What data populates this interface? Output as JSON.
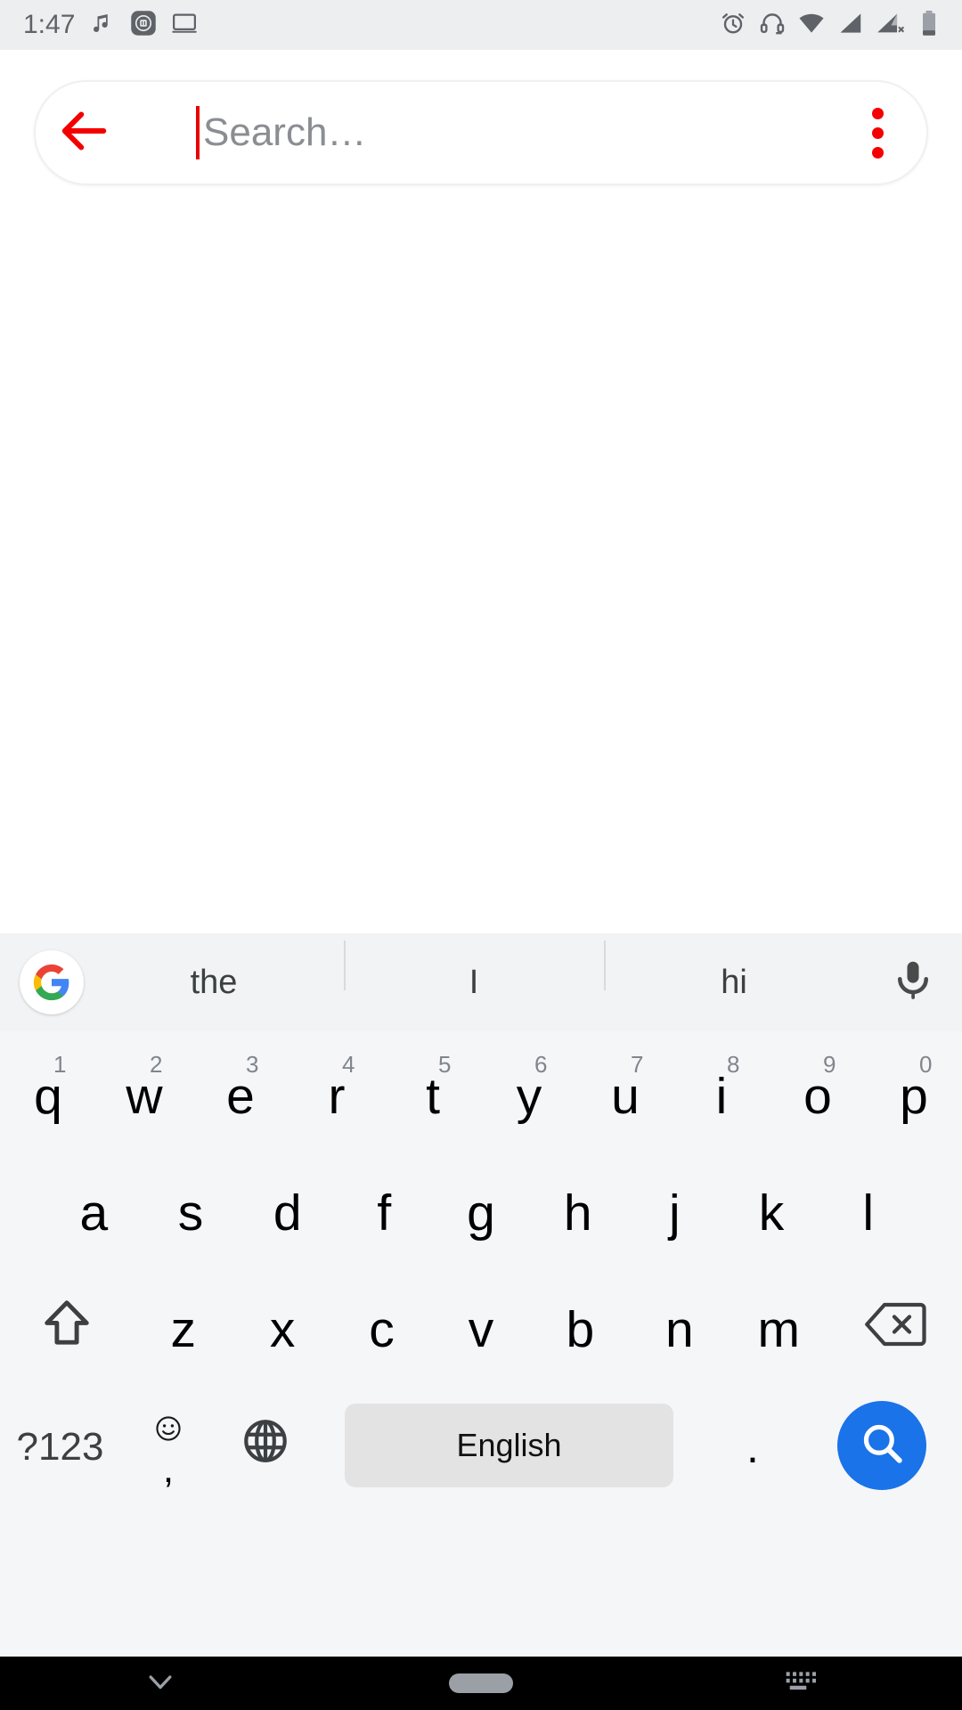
{
  "status_bar": {
    "time": "1:47",
    "left_icons": [
      {
        "name": "music-note-icon",
        "label": "Music playing"
      },
      {
        "name": "mi-app-icon",
        "label": "Mi"
      },
      {
        "name": "cast-screen-icon",
        "label": "Screen cast"
      }
    ],
    "right_icons": [
      {
        "name": "alarm-clock-icon",
        "label": "Alarm set"
      },
      {
        "name": "headset-icon",
        "label": "Headset connected"
      },
      {
        "name": "wifi-icon",
        "label": "Wi-Fi"
      },
      {
        "name": "signal-bars-icon",
        "label": "Signal SIM1"
      },
      {
        "name": "signal-bars-no-service-icon",
        "label": "No service SIM2"
      },
      {
        "name": "battery-icon",
        "label": "Battery"
      }
    ],
    "background": "#eceef0",
    "foreground": "#5f6368"
  },
  "search": {
    "placeholder": "Search…",
    "value": "",
    "back_icon": "arrow-left-icon",
    "overflow_icon": "more-vertical-icon",
    "accent": "#ea0000",
    "caret_color": "#ea0000"
  },
  "keyboard": {
    "logo": "google-g-logo",
    "suggestions": [
      "the",
      "I",
      "hi"
    ],
    "mic_icon": "microphone-icon",
    "rows": {
      "row1": [
        {
          "key": "q",
          "hint": "1"
        },
        {
          "key": "w",
          "hint": "2"
        },
        {
          "key": "e",
          "hint": "3"
        },
        {
          "key": "r",
          "hint": "4"
        },
        {
          "key": "t",
          "hint": "5"
        },
        {
          "key": "y",
          "hint": "6"
        },
        {
          "key": "u",
          "hint": "7"
        },
        {
          "key": "i",
          "hint": "8"
        },
        {
          "key": "o",
          "hint": "9"
        },
        {
          "key": "p",
          "hint": "0"
        }
      ],
      "row2": [
        {
          "key": "a"
        },
        {
          "key": "s"
        },
        {
          "key": "d"
        },
        {
          "key": "f"
        },
        {
          "key": "g"
        },
        {
          "key": "h"
        },
        {
          "key": "j"
        },
        {
          "key": "k"
        },
        {
          "key": "l"
        }
      ],
      "row3": [
        {
          "key": "z"
        },
        {
          "key": "x"
        },
        {
          "key": "c"
        },
        {
          "key": "v"
        },
        {
          "key": "b"
        },
        {
          "key": "n"
        },
        {
          "key": "m"
        }
      ]
    },
    "shift_icon": "shift-arrow-icon",
    "backspace_icon": "backspace-icon",
    "symbols_label": "?123",
    "emoji_icon": "emoji-smiley-icon",
    "comma_label": ",",
    "globe_icon": "globe-language-icon",
    "spacebar_label": "English",
    "period_label": ".",
    "enter_icon": "search-magnifier-icon",
    "enter_color": "#1a73e8",
    "background": "#f5f6f8",
    "suggestion_strip_background": "#f1f3f4",
    "spacebar_background": "#e3e3e3"
  },
  "nav_bar": {
    "items": [
      {
        "name": "back-dismiss-keyboard-icon",
        "label": "Dismiss keyboard"
      },
      {
        "name": "home-pill-icon",
        "label": "Home"
      },
      {
        "name": "keyboard-switcher-icon",
        "label": "Switch keyboard"
      }
    ],
    "background": "#000000"
  }
}
